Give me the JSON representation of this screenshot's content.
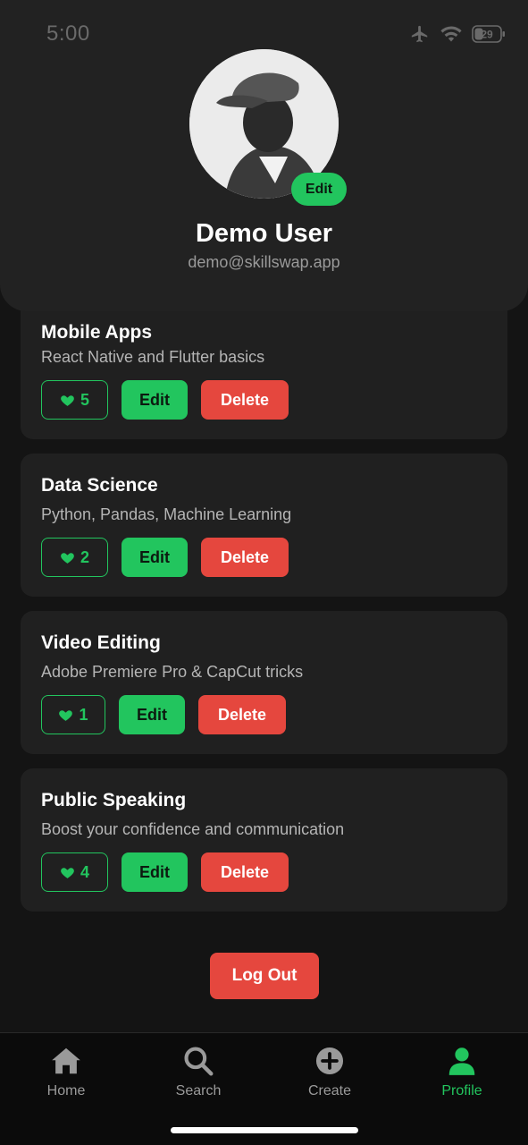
{
  "status_bar": {
    "time": "5:00",
    "battery": "29"
  },
  "profile": {
    "name": "Demo User",
    "email": "demo@skillswap.app",
    "avatar_edit_label": "Edit"
  },
  "skills": [
    {
      "title": "Mobile Apps",
      "description": "React Native and Flutter basics",
      "likes": "5",
      "edit_label": "Edit",
      "delete_label": "Delete"
    },
    {
      "title": "Data Science",
      "description": "Python, Pandas, Machine Learning",
      "likes": "2",
      "edit_label": "Edit",
      "delete_label": "Delete"
    },
    {
      "title": "Video Editing",
      "description": "Adobe Premiere Pro & CapCut tricks",
      "likes": "1",
      "edit_label": "Edit",
      "delete_label": "Delete"
    },
    {
      "title": "Public Speaking",
      "description": "Boost your confidence and communication",
      "likes": "4",
      "edit_label": "Edit",
      "delete_label": "Delete"
    }
  ],
  "logout_label": "Log Out",
  "tabs": [
    {
      "label": "Home",
      "icon": "home-icon"
    },
    {
      "label": "Search",
      "icon": "search-icon"
    },
    {
      "label": "Create",
      "icon": "plus-circle-icon"
    },
    {
      "label": "Profile",
      "icon": "person-icon",
      "active": true
    }
  ],
  "colors": {
    "accent": "#22c55e",
    "danger": "#e5473e",
    "card": "#202020",
    "background": "#141414"
  }
}
